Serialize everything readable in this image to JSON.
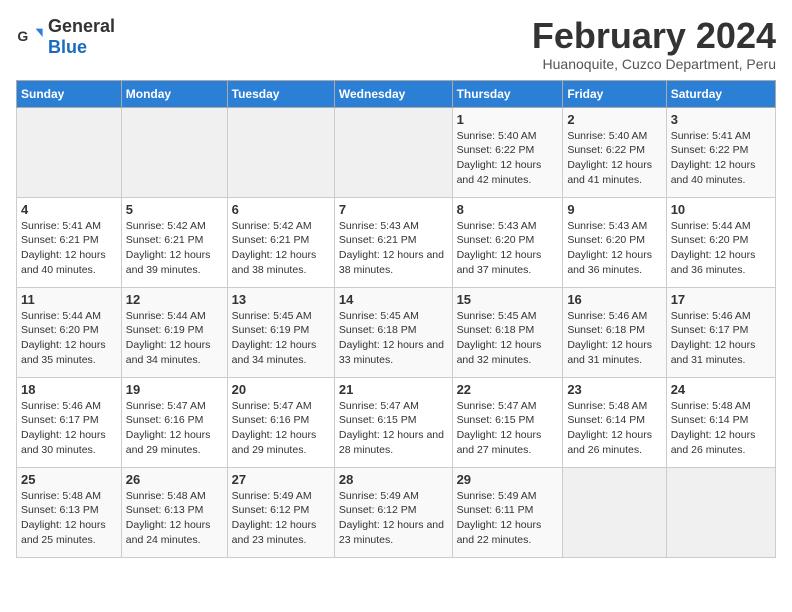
{
  "logo": {
    "general": "General",
    "blue": "Blue"
  },
  "header": {
    "title": "February 2024",
    "subtitle": "Huanoquite, Cuzco Department, Peru"
  },
  "weekdays": [
    "Sunday",
    "Monday",
    "Tuesday",
    "Wednesday",
    "Thursday",
    "Friday",
    "Saturday"
  ],
  "weeks": [
    [
      {
        "day": "",
        "info": ""
      },
      {
        "day": "",
        "info": ""
      },
      {
        "day": "",
        "info": ""
      },
      {
        "day": "",
        "info": ""
      },
      {
        "day": "1",
        "info": "Sunrise: 5:40 AM\nSunset: 6:22 PM\nDaylight: 12 hours and 42 minutes."
      },
      {
        "day": "2",
        "info": "Sunrise: 5:40 AM\nSunset: 6:22 PM\nDaylight: 12 hours and 41 minutes."
      },
      {
        "day": "3",
        "info": "Sunrise: 5:41 AM\nSunset: 6:22 PM\nDaylight: 12 hours and 40 minutes."
      }
    ],
    [
      {
        "day": "4",
        "info": "Sunrise: 5:41 AM\nSunset: 6:21 PM\nDaylight: 12 hours and 40 minutes."
      },
      {
        "day": "5",
        "info": "Sunrise: 5:42 AM\nSunset: 6:21 PM\nDaylight: 12 hours and 39 minutes."
      },
      {
        "day": "6",
        "info": "Sunrise: 5:42 AM\nSunset: 6:21 PM\nDaylight: 12 hours and 38 minutes."
      },
      {
        "day": "7",
        "info": "Sunrise: 5:43 AM\nSunset: 6:21 PM\nDaylight: 12 hours and 38 minutes."
      },
      {
        "day": "8",
        "info": "Sunrise: 5:43 AM\nSunset: 6:20 PM\nDaylight: 12 hours and 37 minutes."
      },
      {
        "day": "9",
        "info": "Sunrise: 5:43 AM\nSunset: 6:20 PM\nDaylight: 12 hours and 36 minutes."
      },
      {
        "day": "10",
        "info": "Sunrise: 5:44 AM\nSunset: 6:20 PM\nDaylight: 12 hours and 36 minutes."
      }
    ],
    [
      {
        "day": "11",
        "info": "Sunrise: 5:44 AM\nSunset: 6:20 PM\nDaylight: 12 hours and 35 minutes."
      },
      {
        "day": "12",
        "info": "Sunrise: 5:44 AM\nSunset: 6:19 PM\nDaylight: 12 hours and 34 minutes."
      },
      {
        "day": "13",
        "info": "Sunrise: 5:45 AM\nSunset: 6:19 PM\nDaylight: 12 hours and 34 minutes."
      },
      {
        "day": "14",
        "info": "Sunrise: 5:45 AM\nSunset: 6:18 PM\nDaylight: 12 hours and 33 minutes."
      },
      {
        "day": "15",
        "info": "Sunrise: 5:45 AM\nSunset: 6:18 PM\nDaylight: 12 hours and 32 minutes."
      },
      {
        "day": "16",
        "info": "Sunrise: 5:46 AM\nSunset: 6:18 PM\nDaylight: 12 hours and 31 minutes."
      },
      {
        "day": "17",
        "info": "Sunrise: 5:46 AM\nSunset: 6:17 PM\nDaylight: 12 hours and 31 minutes."
      }
    ],
    [
      {
        "day": "18",
        "info": "Sunrise: 5:46 AM\nSunset: 6:17 PM\nDaylight: 12 hours and 30 minutes."
      },
      {
        "day": "19",
        "info": "Sunrise: 5:47 AM\nSunset: 6:16 PM\nDaylight: 12 hours and 29 minutes."
      },
      {
        "day": "20",
        "info": "Sunrise: 5:47 AM\nSunset: 6:16 PM\nDaylight: 12 hours and 29 minutes."
      },
      {
        "day": "21",
        "info": "Sunrise: 5:47 AM\nSunset: 6:15 PM\nDaylight: 12 hours and 28 minutes."
      },
      {
        "day": "22",
        "info": "Sunrise: 5:47 AM\nSunset: 6:15 PM\nDaylight: 12 hours and 27 minutes."
      },
      {
        "day": "23",
        "info": "Sunrise: 5:48 AM\nSunset: 6:14 PM\nDaylight: 12 hours and 26 minutes."
      },
      {
        "day": "24",
        "info": "Sunrise: 5:48 AM\nSunset: 6:14 PM\nDaylight: 12 hours and 26 minutes."
      }
    ],
    [
      {
        "day": "25",
        "info": "Sunrise: 5:48 AM\nSunset: 6:13 PM\nDaylight: 12 hours and 25 minutes."
      },
      {
        "day": "26",
        "info": "Sunrise: 5:48 AM\nSunset: 6:13 PM\nDaylight: 12 hours and 24 minutes."
      },
      {
        "day": "27",
        "info": "Sunrise: 5:49 AM\nSunset: 6:12 PM\nDaylight: 12 hours and 23 minutes."
      },
      {
        "day": "28",
        "info": "Sunrise: 5:49 AM\nSunset: 6:12 PM\nDaylight: 12 hours and 23 minutes."
      },
      {
        "day": "29",
        "info": "Sunrise: 5:49 AM\nSunset: 6:11 PM\nDaylight: 12 hours and 22 minutes."
      },
      {
        "day": "",
        "info": ""
      },
      {
        "day": "",
        "info": ""
      }
    ]
  ]
}
